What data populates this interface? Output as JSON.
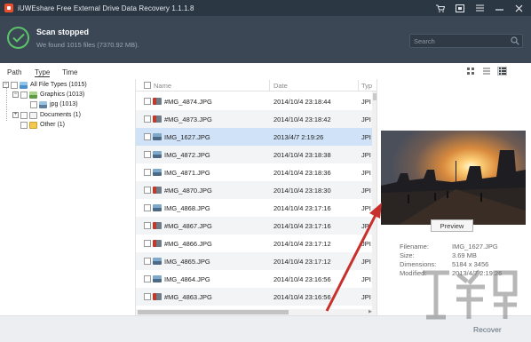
{
  "window": {
    "title": "iUWEshare Free External Drive Data Recovery 1.1.1.8",
    "controls": [
      "cart-icon",
      "register-icon",
      "menu-icon",
      "minimize-icon",
      "close-icon"
    ]
  },
  "status": {
    "title": "Scan stopped",
    "subtitle": "We found 1015 files (7370.92 MB)."
  },
  "search": {
    "placeholder": "Search"
  },
  "view_tabs": [
    {
      "label": "Path",
      "active": false
    },
    {
      "label": "Type",
      "active": true
    },
    {
      "label": "Time",
      "active": false
    }
  ],
  "view_modes": [
    "grid-view-icon",
    "list-view-icon",
    "detail-view-icon"
  ],
  "tree": {
    "root": "All File Types (1015)",
    "graphics": "Graphics (1013)",
    "jpg": "jpg (1013)",
    "documents": "Documents (1)",
    "other": "Other (1)"
  },
  "columns": {
    "name": "Name",
    "date": "Date",
    "type": "Typ"
  },
  "files": [
    {
      "name": "#MG_4874.JPG",
      "date": "2014/10/4 23:18:44",
      "type": "JPI",
      "deleted": true
    },
    {
      "name": "#MG_4873.JPG",
      "date": "2014/10/4 23:18:42",
      "type": "JPI",
      "deleted": true
    },
    {
      "name": "IMG_1627.JPG",
      "date": "2013/4/7 2:19:26",
      "type": "JPI",
      "deleted": false,
      "selected": true
    },
    {
      "name": "IMG_4872.JPG",
      "date": "2014/10/4 23:18:38",
      "type": "JPI",
      "deleted": false
    },
    {
      "name": "IMG_4871.JPG",
      "date": "2014/10/4 23:18:36",
      "type": "JPI",
      "deleted": false
    },
    {
      "name": "#MG_4870.JPG",
      "date": "2014/10/4 23:18:30",
      "type": "JPI",
      "deleted": true
    },
    {
      "name": "IMG_4868.JPG",
      "date": "2014/10/4 23:17:16",
      "type": "JPI",
      "deleted": false
    },
    {
      "name": "#MG_4867.JPG",
      "date": "2014/10/4 23:17:16",
      "type": "JPI",
      "deleted": true
    },
    {
      "name": "#MG_4866.JPG",
      "date": "2014/10/4 23:17:12",
      "type": "JPI",
      "deleted": true
    },
    {
      "name": "IMG_4865.JPG",
      "date": "2014/10/4 23:17:12",
      "type": "JPI",
      "deleted": false
    },
    {
      "name": "IMG_4864.JPG",
      "date": "2014/10/4 23:16:56",
      "type": "JPI",
      "deleted": false
    },
    {
      "name": "#MG_4863.JPG",
      "date": "2014/10/4 23:16:56",
      "type": "JPI",
      "deleted": true
    }
  ],
  "preview": {
    "button_label": "Preview",
    "filename_label": "Filename:",
    "filename": "IMG_1627.JPG",
    "size_label": "Size:",
    "size": "3.69 MB",
    "dimensions_label": "Dimensions:",
    "dimensions": "5184 x 3456",
    "modified_label": "Modified:",
    "modified": "2013/4/7 2:19:26"
  },
  "footer": {
    "recover_label": "Recover"
  },
  "colors": {
    "titlebar": "#2c3744",
    "header": "#3b4755",
    "success": "#5cc36a",
    "selected_row": "#cfe2f7",
    "annotation_arrow": "#c8302c"
  }
}
